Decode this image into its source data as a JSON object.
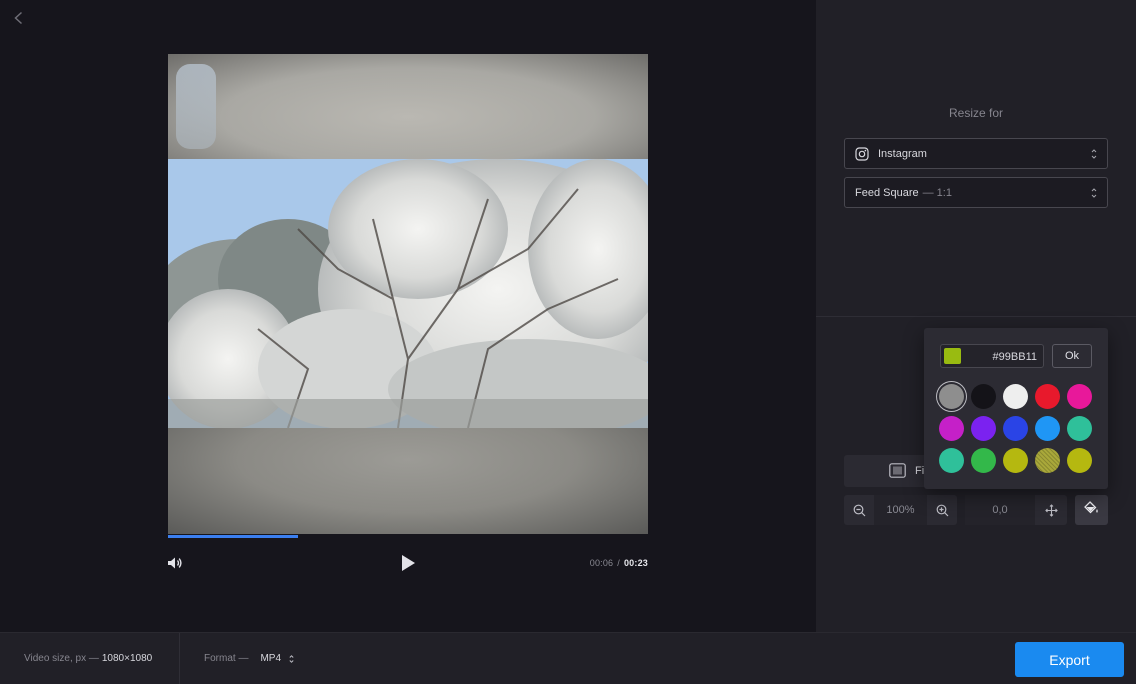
{
  "player": {
    "current_time": "00:06",
    "separator": "/",
    "total_time": "00:23",
    "progress_fraction": 0.27
  },
  "sidebar": {
    "resize_title": "Resize for",
    "platform_select": {
      "value": "Instagram",
      "icon": "instagram-icon"
    },
    "preset_select": {
      "name": "Feed Square",
      "ratio": "— 1:1"
    },
    "fit_button_label": "Fi",
    "zoom": {
      "value": "100%"
    },
    "position": {
      "value": "0,0"
    }
  },
  "color_picker": {
    "hex_value": "#99BB11",
    "current_color": "#99BB11",
    "ok_label": "Ok",
    "swatches": [
      {
        "color": "#8e8e8e",
        "selected": true,
        "hatched": false
      },
      {
        "color": "#141318",
        "selected": false,
        "hatched": false
      },
      {
        "color": "#eeeeee",
        "selected": false,
        "hatched": false
      },
      {
        "color": "#e8192c",
        "selected": false,
        "hatched": false
      },
      {
        "color": "#e8189a",
        "selected": false,
        "hatched": false
      },
      {
        "color": "#c520c8",
        "selected": false,
        "hatched": false
      },
      {
        "color": "#7b22f0",
        "selected": false,
        "hatched": false
      },
      {
        "color": "#2a44e6",
        "selected": false,
        "hatched": false
      },
      {
        "color": "#1f96f5",
        "selected": false,
        "hatched": false
      },
      {
        "color": "#2fc09a",
        "selected": false,
        "hatched": false
      },
      {
        "color": "#2fc09a",
        "selected": false,
        "hatched": false
      },
      {
        "color": "#33b84a",
        "selected": false,
        "hatched": false
      },
      {
        "color": "#b5b810",
        "selected": false,
        "hatched": false
      },
      {
        "color": "#a9a83a",
        "selected": false,
        "hatched": true
      },
      {
        "color": "#b5b810",
        "selected": false,
        "hatched": false
      }
    ]
  },
  "bottombar": {
    "video_size_label": "Video size, px —",
    "video_size_value": "1080×1080",
    "format_label": "Format —",
    "format_value": "MP4",
    "export_label": "Export"
  },
  "colors": {
    "accent": "#1a8af0",
    "progress": "#3b7ff0",
    "background": "#16151c",
    "panel": "#212027"
  }
}
